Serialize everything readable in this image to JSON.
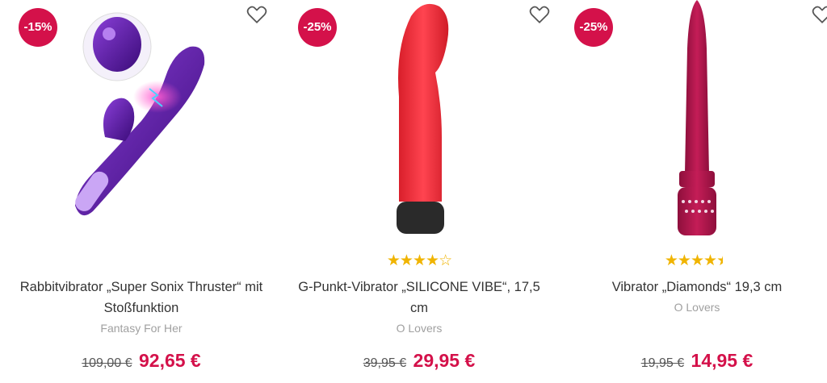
{
  "products": [
    {
      "discount": "-15%",
      "rating": null,
      "title": "Rabbitvibrator „Super Sonix Thruster“ mit Stoßfunktion",
      "brand": "Fantasy For Her",
      "old_price": "109,00 €",
      "new_price": "92,65 €",
      "color": "#5b1fa0"
    },
    {
      "discount": "-25%",
      "rating": "4 of 5",
      "title": "G-Punkt-Vibrator „SILICONE VIBE“, 17,5 cm",
      "brand": "O Lovers",
      "old_price": "39,95 €",
      "new_price": "29,95 €",
      "color": "#ee2d3a"
    },
    {
      "discount": "-25%",
      "rating": "4.5 of 5",
      "title": "Vibrator „Diamonds“ 19,3 cm",
      "brand": "O Lovers",
      "old_price": "19,95 €",
      "new_price": "14,95 €",
      "color": "#b8174f"
    }
  ],
  "icons": {
    "wishlist": "heart-outline-icon",
    "rating": "star-icon"
  },
  "colors": {
    "accent": "#d4114a",
    "star": "#f0b400"
  }
}
